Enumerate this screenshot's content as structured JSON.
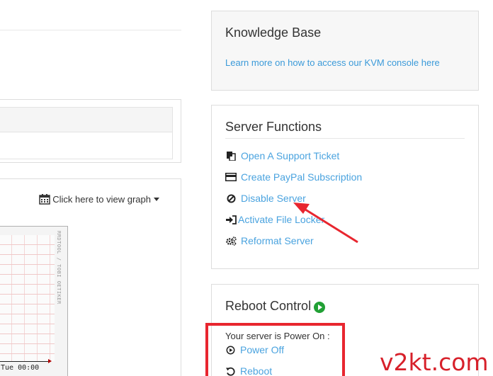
{
  "knowledge_base": {
    "title": "Knowledge Base",
    "link": "Learn more on how to access our KVM console here"
  },
  "server_functions": {
    "title": "Server Functions",
    "items": [
      {
        "label": "Open A Support Ticket",
        "icon": "ticket-icon"
      },
      {
        "label": "Create PayPal Subscription",
        "icon": "credit-card-icon"
      },
      {
        "label": "Disable Server",
        "icon": "ban-icon"
      },
      {
        "label": "Activate File Locker",
        "icon": "sign-in-icon"
      },
      {
        "label": "Reformat Server",
        "icon": "cogs-icon"
      }
    ]
  },
  "reboot_control": {
    "title": "Reboot Control",
    "status_icon": "play-circle-icon",
    "status_text": "Your server is Power On :",
    "power_off_label": "Power Off",
    "reboot_label": "Reboot"
  },
  "graph": {
    "link_label": "Click here to view graph",
    "x_label": "Tue 00:00",
    "side_label": "RRDTOOL / TOBI OETIKER"
  },
  "watermark": "v2kt.com",
  "colors": {
    "link": "#4aa3df",
    "highlight": "#e8262f",
    "status_green": "#21a035"
  }
}
